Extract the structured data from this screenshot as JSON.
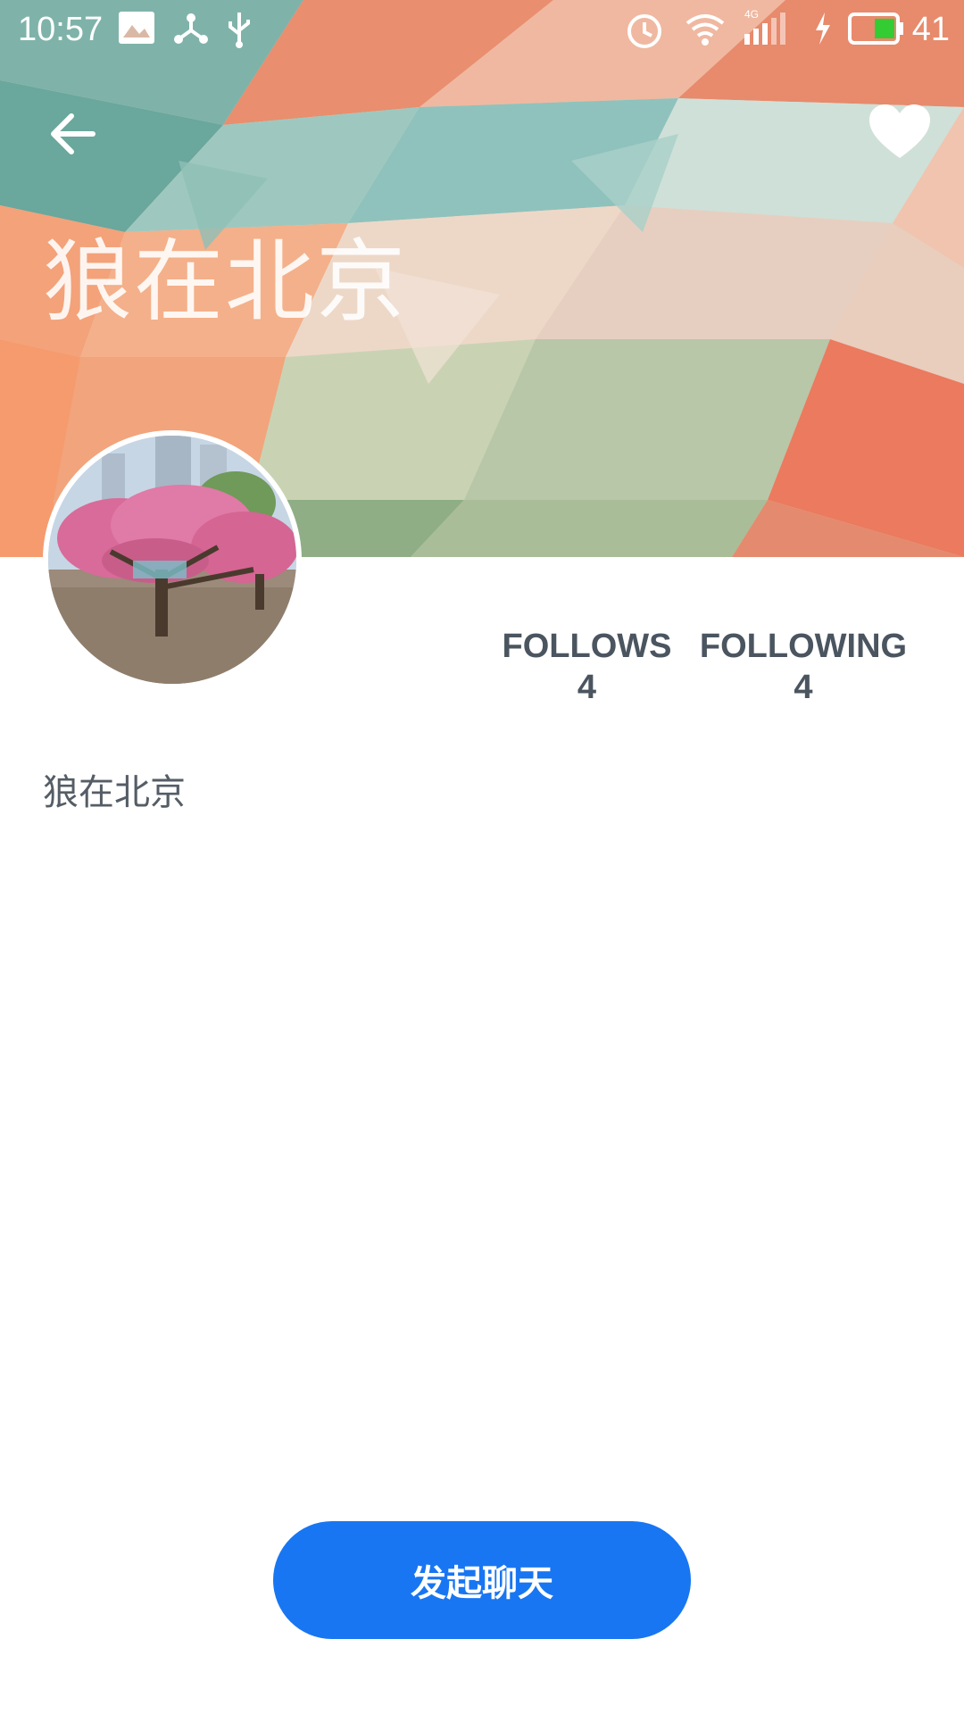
{
  "status_bar": {
    "time": "10:57",
    "network": "4G",
    "battery": "41",
    "icons": [
      "image-icon",
      "share-icon",
      "usb-icon",
      "alarm-icon",
      "wifi-icon",
      "signal-icon",
      "charging-icon",
      "battery-icon"
    ]
  },
  "header": {
    "title": "狼在北京",
    "back_icon": "arrow-left-icon",
    "favorite_icon": "heart-icon"
  },
  "profile": {
    "avatar_alt": "avatar-photo",
    "stats": [
      {
        "label": "FOLLOWS",
        "value": "4"
      },
      {
        "label": "FOLLOWING",
        "value": "4"
      }
    ],
    "bio": "狼在北京"
  },
  "actions": {
    "start_chat_label": "发起聊天"
  },
  "colors": {
    "accent": "#1876f2",
    "stat_text": "#4a5560",
    "bio_text": "#555d66"
  }
}
